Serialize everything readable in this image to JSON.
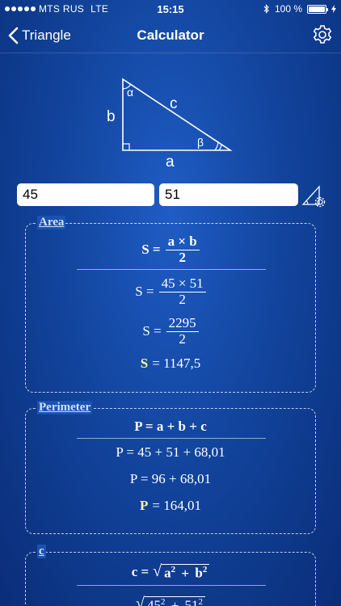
{
  "status_bar": {
    "carrier": "MTS RUS",
    "network": "LTE",
    "time": "15:15",
    "battery_percent": "100 %",
    "battery_level": 1.0
  },
  "nav": {
    "back_label": "Triangle",
    "title": "Calculator"
  },
  "diagram": {
    "label_a": "a",
    "label_b": "b",
    "label_c": "c",
    "label_alpha": "α",
    "label_beta": "β"
  },
  "inputs": {
    "a_value": "45",
    "b_value": "51"
  },
  "area": {
    "title": "Area",
    "formula_lhs": "S =",
    "formula_num": "a × b",
    "formula_den": "2",
    "step1_lhs": "S =",
    "step1_num": "45 × 51",
    "step1_den": "2",
    "step2_lhs": "S =",
    "step2_num": "2295",
    "step2_den": "2",
    "result_lhs": "S",
    "result_rhs": "= 1147,5"
  },
  "perimeter": {
    "title": "Perimeter",
    "formula": "P = a + b + c",
    "step1": "P = 45 + 51 + 68,01",
    "step2": "P = 96 + 68,01",
    "result_lhs": "P",
    "result_rhs": "= 164,01"
  },
  "hypotenuse": {
    "title": "c",
    "formula_lhs": "c =",
    "formula_term1": "a",
    "formula_plus": "+",
    "formula_term2": "b",
    "exp": "2",
    "step1_term1": "45",
    "step1_term2": "51"
  },
  "colors": {
    "background": "#12459e",
    "result_highlight": "#fff7a8",
    "section_title": "#cfe0ff"
  }
}
